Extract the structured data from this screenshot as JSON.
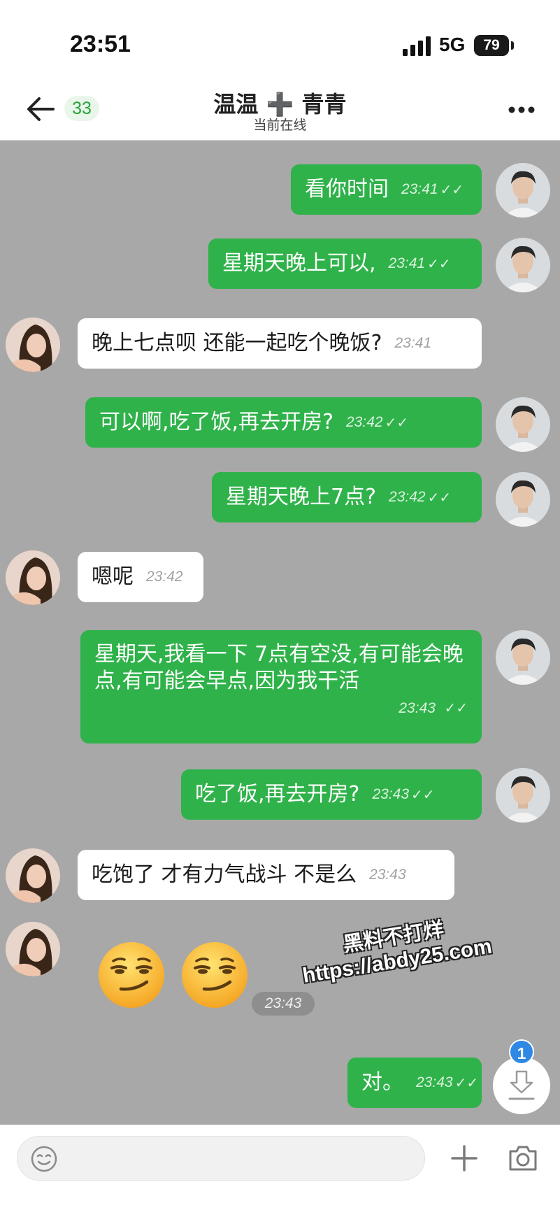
{
  "status_bar": {
    "time": "23:51",
    "network": "5G",
    "battery": "79"
  },
  "header": {
    "unread_count": "33",
    "title": "温温 ➕ 青青",
    "subtitle": "当前在线"
  },
  "messages": [
    {
      "direction": "out",
      "text": "看你时间",
      "time": "23:41",
      "check": "✓✓"
    },
    {
      "direction": "out",
      "text": "星期天晚上可以,",
      "time": "23:41",
      "check": "✓✓"
    },
    {
      "direction": "in",
      "text": "晚上七点呗 还能一起吃个晚饭?",
      "time": "23:41"
    },
    {
      "direction": "out",
      "text": "可以啊,吃了饭,再去开房?",
      "time": "23:42",
      "check": "✓✓"
    },
    {
      "direction": "out",
      "text": "星期天晚上7点?",
      "time": "23:42",
      "check": "✓✓"
    },
    {
      "direction": "in",
      "text": "嗯呢",
      "time": "23:42"
    },
    {
      "direction": "out",
      "text": "星期天,我看一下 7点有空没,有可能会晚点,有可能会早点,因为我干活",
      "time": "23:43",
      "check": "✓✓"
    },
    {
      "direction": "out",
      "text": "吃了饭,再去开房?",
      "time": "23:43",
      "check": "✓✓"
    },
    {
      "direction": "in",
      "text": "吃饱了 才有力气战斗 不是么",
      "time": "23:43"
    },
    {
      "direction": "in",
      "text": "",
      "time": "23:43",
      "emoji": [
        "smirking-face",
        "smirking-face"
      ]
    },
    {
      "direction": "out",
      "text": "对。",
      "time": "23:43",
      "check": "✓✓"
    }
  ],
  "watermark": {
    "line1": "黑料不打烊",
    "line2": "https://abdy25.com"
  },
  "download_badge": "1",
  "input": {
    "placeholder": ""
  },
  "colors": {
    "outgoing_bubble": "#2fb24a",
    "incoming_bubble": "#ffffff",
    "chat_background": "#a8a8a8",
    "badge_blue": "#2e88e4"
  }
}
